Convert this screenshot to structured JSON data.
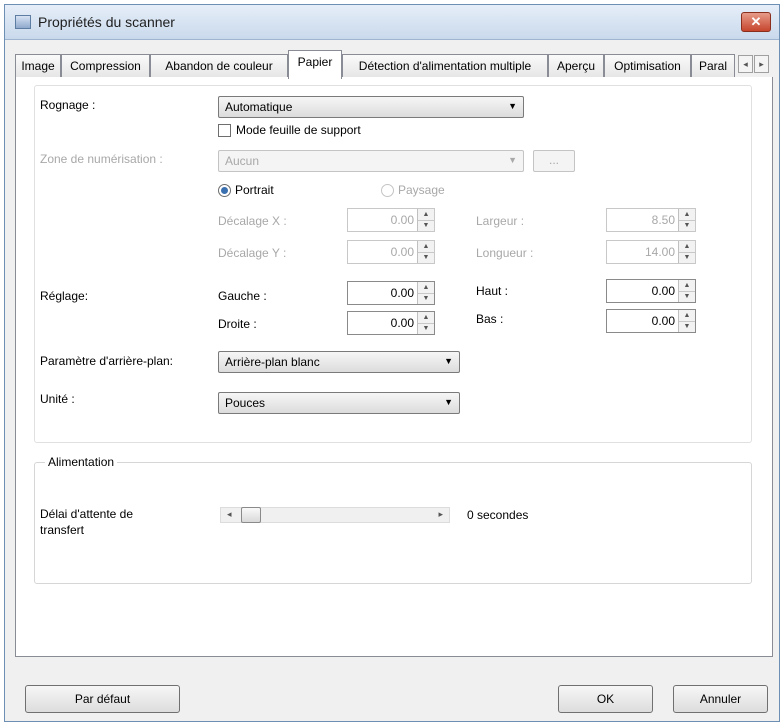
{
  "window": {
    "title": "Propriétés du scanner",
    "close_glyph": "✕"
  },
  "tabs": [
    {
      "label": "Image"
    },
    {
      "label": "Compression"
    },
    {
      "label": "Abandon de couleur"
    },
    {
      "label": "Papier"
    },
    {
      "label": "Détection d'alimentation multiple"
    },
    {
      "label": "Aperçu"
    },
    {
      "label": "Optimisation"
    },
    {
      "label": "Paral"
    }
  ],
  "tab_scroll": {
    "left": "◂",
    "right": "▸"
  },
  "active_tab": "Papier",
  "paper": {
    "rognage_label": "Rognage :",
    "rognage_value": "Automatique",
    "mode_feuille_label": "Mode feuille de support",
    "zone_label": "Zone de numérisation :",
    "zone_value": "Aucun",
    "zone_button": "...",
    "portrait_label": "Portrait",
    "paysage_label": "Paysage",
    "decalage_x_label": "Décalage X :",
    "decalage_x_value": "0.00",
    "decalage_y_label": "Décalage Y :",
    "decalage_y_value": "0.00",
    "largeur_label": "Largeur :",
    "largeur_value": "8.50",
    "longueur_label": "Longueur :",
    "longueur_value": "14.00",
    "reglage_label": "Réglage:",
    "gauche_label": "Gauche :",
    "gauche_value": "0.00",
    "droite_label": "Droite :",
    "droite_value": "0.00",
    "haut_label": "Haut :",
    "haut_value": "0.00",
    "bas_label": "Bas :",
    "bas_value": "0.00",
    "arriere_plan_label": "Paramètre d'arrière-plan:",
    "arriere_plan_value": "Arrière-plan blanc",
    "unite_label": "Unité :",
    "unite_value": "Pouces"
  },
  "alimentation": {
    "group_label": "Alimentation",
    "delai_label_line1": "Délai d'attente de",
    "delai_label_line2": "transfert",
    "delai_value": "0 secondes",
    "delai_fraction": 0.0
  },
  "buttons": {
    "default": "Par défaut",
    "ok": "OK",
    "cancel": "Annuler"
  },
  "glyphs": {
    "dropdown": "▼",
    "up": "▲",
    "down": "▼",
    "slider_left": "◂",
    "slider_right": "▸"
  }
}
